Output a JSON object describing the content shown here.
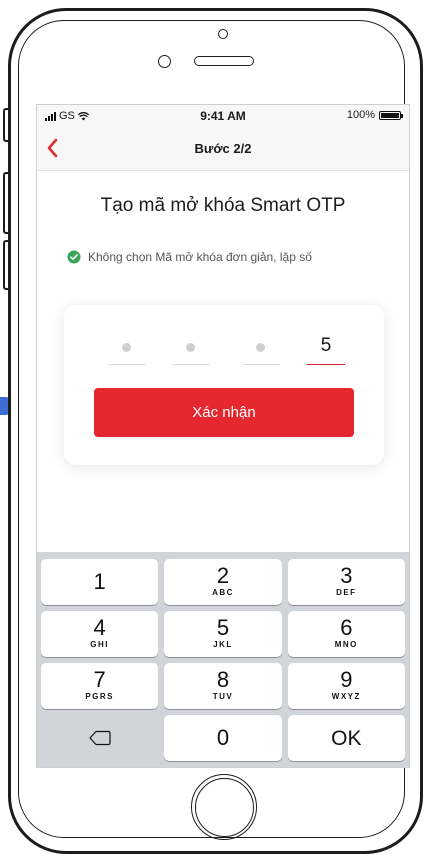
{
  "status_bar": {
    "carrier": "GS",
    "time": "9:41 AM",
    "battery": "100%",
    "signal_icon": "signal-bars-icon",
    "wifi_icon": "wifi-icon"
  },
  "nav": {
    "back_icon": "chevron-left-icon",
    "title": "Bước 2/2"
  },
  "main": {
    "title": "Tạo mã mở khóa Smart OTP",
    "rule_icon": "check-circle-icon",
    "rule_text": "Không chọn Mã mở khóa đơn giản, lặp số",
    "pin": [
      {
        "filled": false,
        "digit": ""
      },
      {
        "filled": false,
        "digit": ""
      },
      {
        "filled": false,
        "digit": ""
      },
      {
        "filled": true,
        "digit": "5"
      }
    ],
    "confirm_label": "Xác nhận"
  },
  "keypad": {
    "keys": [
      {
        "num": "1",
        "letters": ""
      },
      {
        "num": "2",
        "letters": "ABC"
      },
      {
        "num": "3",
        "letters": "DEF"
      },
      {
        "num": "4",
        "letters": "GHI"
      },
      {
        "num": "5",
        "letters": "JKL"
      },
      {
        "num": "6",
        "letters": "MNO"
      },
      {
        "num": "7",
        "letters": "PGRS"
      },
      {
        "num": "8",
        "letters": "TUV"
      },
      {
        "num": "9",
        "letters": "WXYZ"
      }
    ],
    "zero": "0",
    "ok": "OK",
    "delete_icon": "backspace-icon"
  },
  "colors": {
    "accent": "#e52830",
    "check": "#3ba55c",
    "keypad_bg": "#d1d4d9"
  }
}
